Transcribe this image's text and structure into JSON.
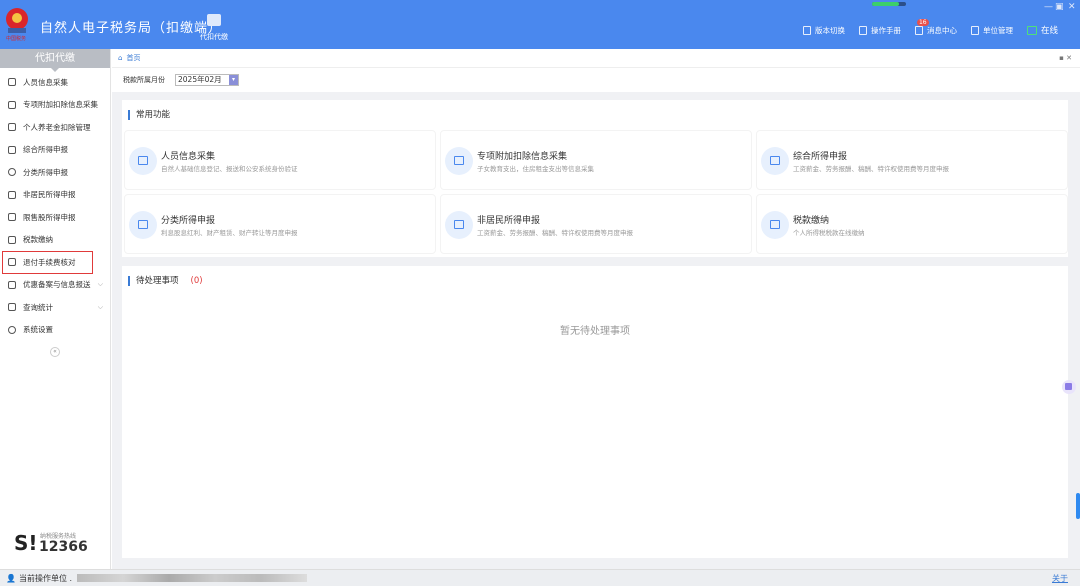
{
  "header": {
    "title": "自然人电子税务局（扣缴端）",
    "nav_main": "代扣代缴",
    "tools": [
      {
        "label": "版本切换",
        "icon": "doc-icon"
      },
      {
        "label": "操作手册",
        "icon": "doc-icon"
      },
      {
        "label": "消息中心",
        "icon": "mail-icon",
        "badge": "16"
      },
      {
        "label": "单位管理",
        "icon": "building-icon"
      }
    ],
    "online": "在线",
    "sync_progress": 0.8
  },
  "sidebar": {
    "title": "代扣代缴",
    "items": [
      {
        "label": "人员信息采集"
      },
      {
        "label": "专项附加扣除信息采集"
      },
      {
        "label": "个人养老金扣除管理"
      },
      {
        "label": "综合所得申报"
      },
      {
        "label": "分类所得申报"
      },
      {
        "label": "非居民所得申报"
      },
      {
        "label": "限售股所得申报"
      },
      {
        "label": "税款缴纳"
      },
      {
        "label": "退付手续费核对"
      },
      {
        "label": "优惠备案与信息报送"
      },
      {
        "label": "查询统计"
      },
      {
        "label": "系统设置"
      }
    ],
    "collapse": "«",
    "hotline_label": "纳税服务热线",
    "hotline_number": "12366"
  },
  "main": {
    "breadcrumb": "首页",
    "month_label": "税款所属月份",
    "month_value": "2025年02月",
    "common_title": "常用功能",
    "functions": [
      {
        "title": "人员信息采集",
        "desc": "自然人基础信息登记、报送和公安系统身份验证"
      },
      {
        "title": "专项附加扣除信息采集",
        "desc": "子女教育支出，住房租金支出等信息采集"
      },
      {
        "title": "综合所得申报",
        "desc": "工资薪金、劳务报酬、稿酬、特许权使用费等月度申报"
      },
      {
        "title": "分类所得申报",
        "desc": "利息股息红利、财产租赁、财产转让等月度申报"
      },
      {
        "title": "非居民所得申报",
        "desc": "工资薪金、劳务报酬、稿酬、特许权使用费等月度申报"
      },
      {
        "title": "税款缴纳",
        "desc": "个人所得税税款在线缴纳"
      }
    ],
    "pending_title": "待处理事项",
    "pending_count": "(0)",
    "pending_empty": "暂无待处理事项"
  },
  "status": {
    "unit_label": "当前操作单位 .",
    "about": "关于"
  },
  "colors": {
    "header": "#4a88ee",
    "highlight": "#e03a3a",
    "accent": "#3a7bd5"
  }
}
